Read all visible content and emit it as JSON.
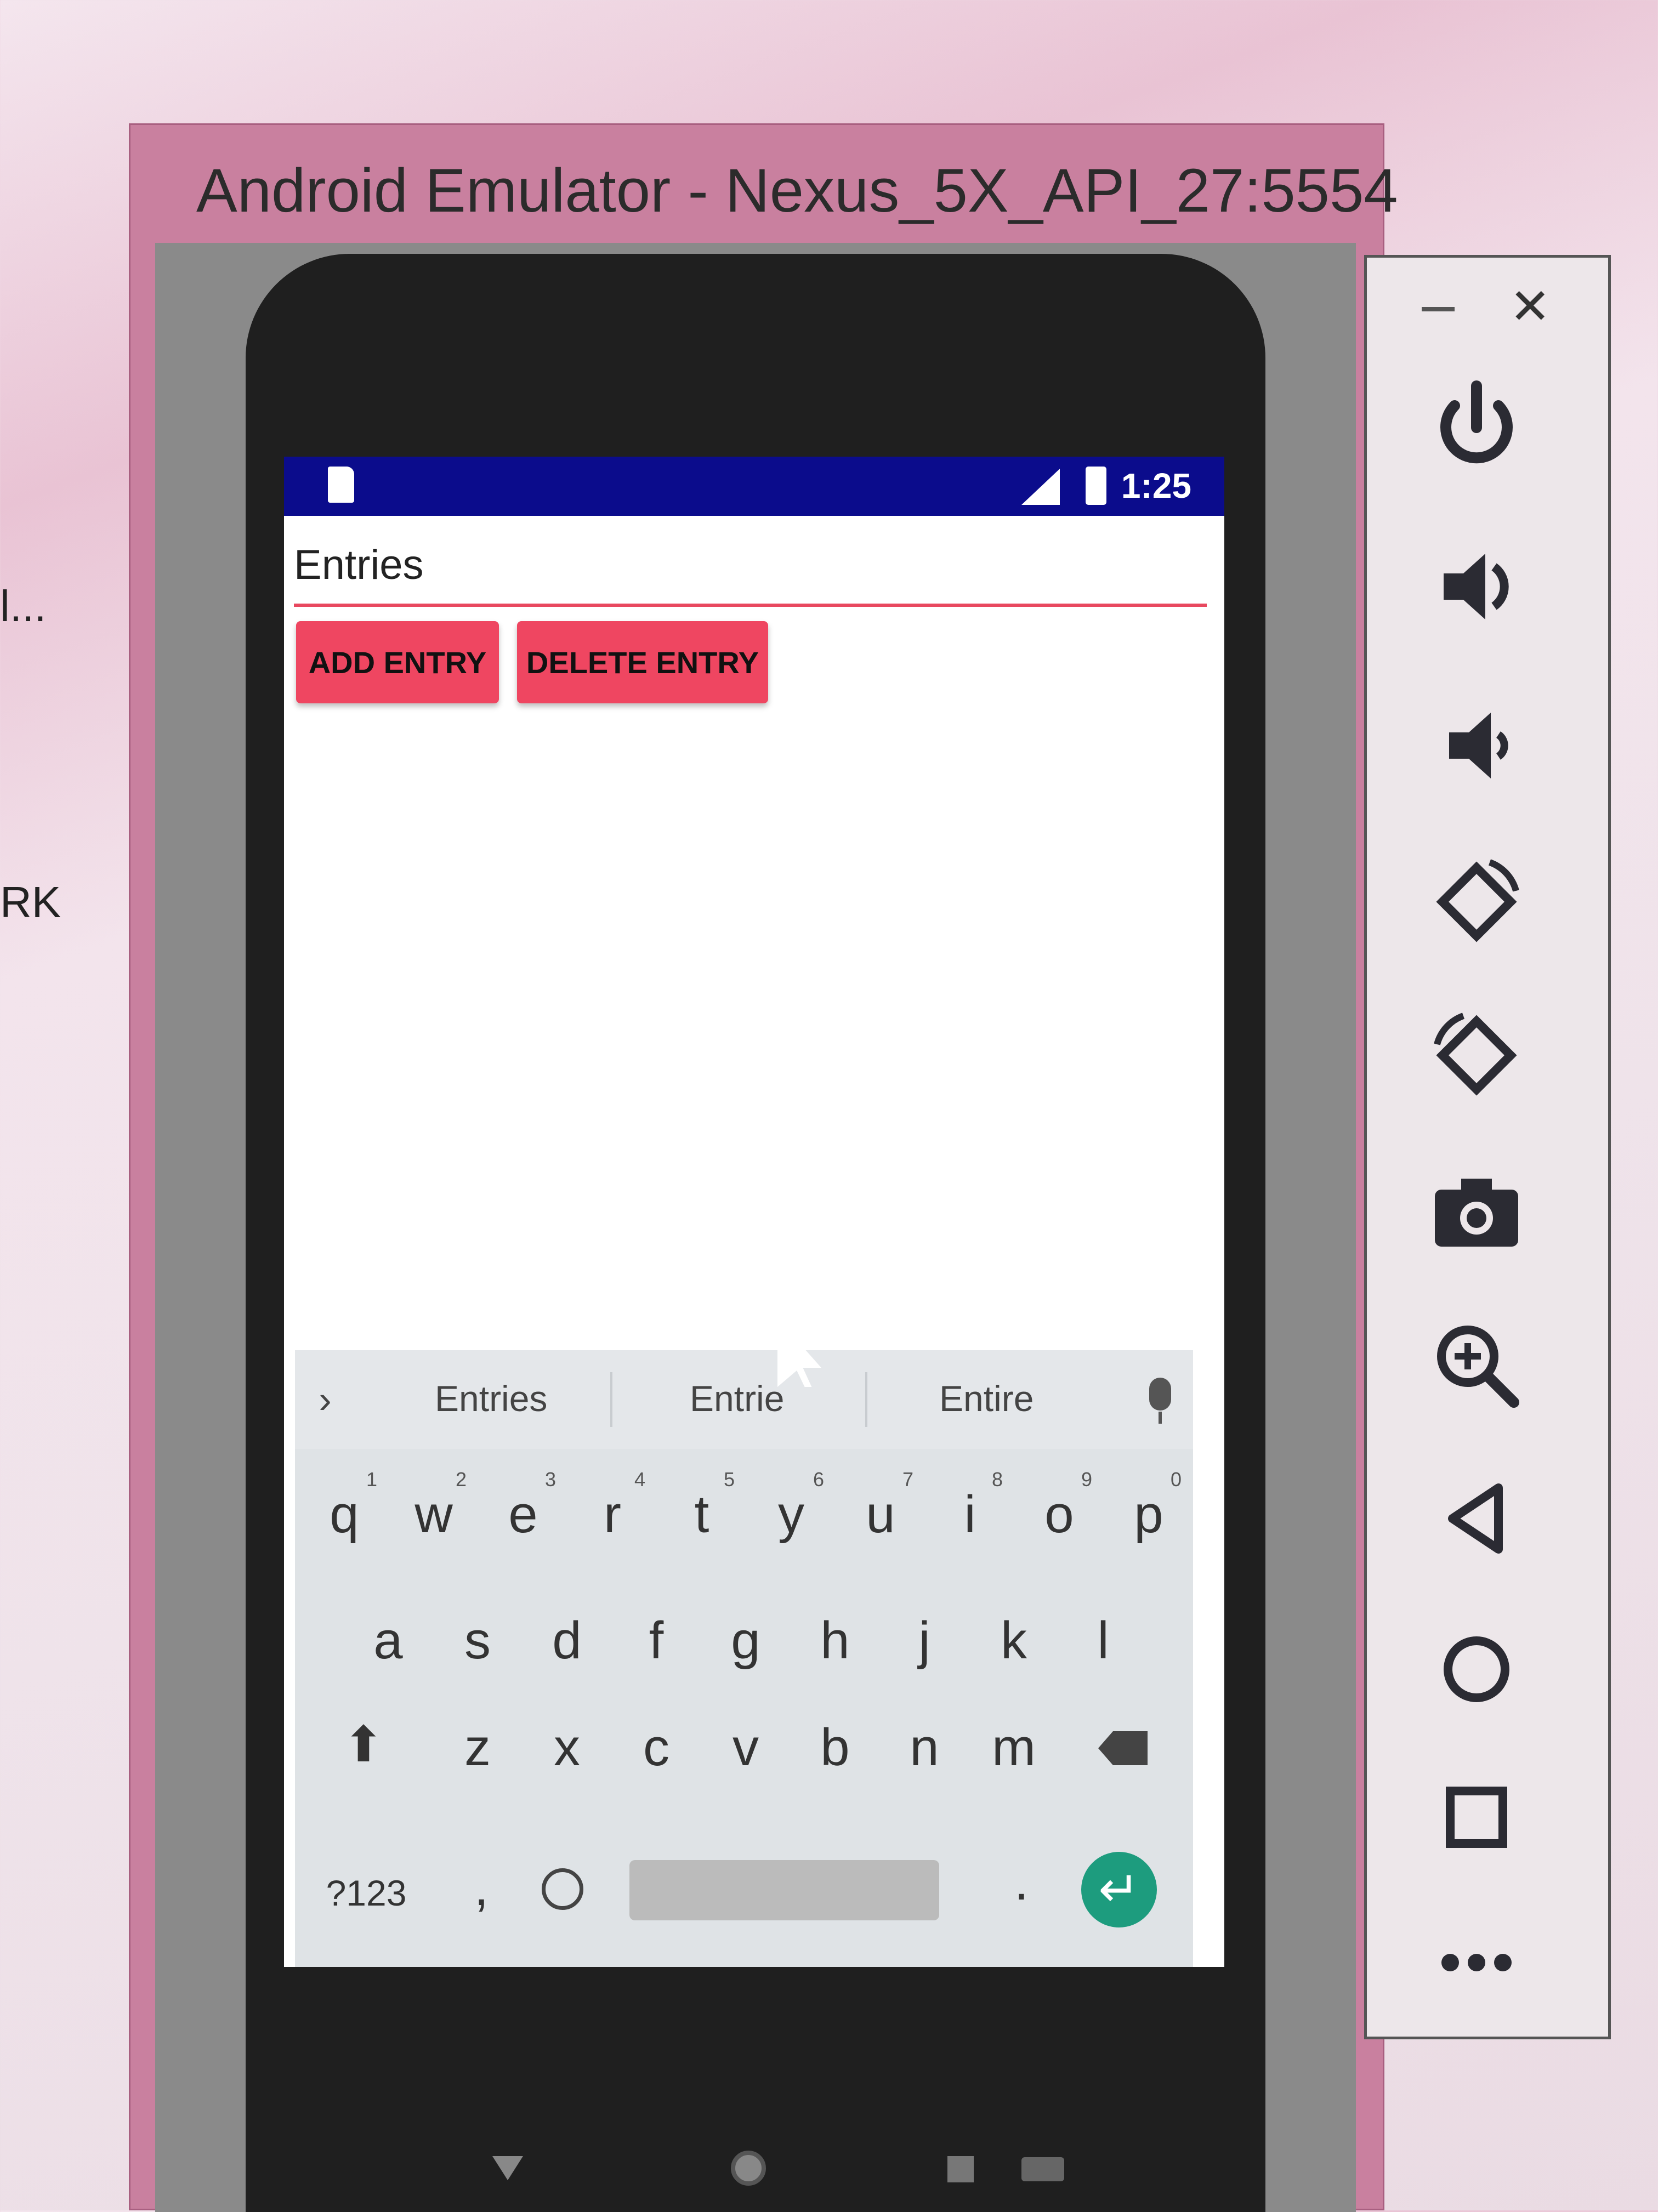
{
  "window": {
    "title": "Android Emulator - Nexus_5X_API_27:5554"
  },
  "desktop": {
    "left_labels": [
      "l...",
      "RK"
    ]
  },
  "status_bar": {
    "time": "1:25"
  },
  "app": {
    "entry_field_value": "Entries",
    "add_button_label": "ADD ENTRY",
    "delete_button_label": "DELETE ENTRY"
  },
  "keyboard": {
    "suggestions": [
      "Entries",
      "Entrie",
      "Entire"
    ],
    "row1": [
      {
        "key": "q",
        "hint": "1"
      },
      {
        "key": "w",
        "hint": "2"
      },
      {
        "key": "e",
        "hint": "3"
      },
      {
        "key": "r",
        "hint": "4"
      },
      {
        "key": "t",
        "hint": "5"
      },
      {
        "key": "y",
        "hint": "6"
      },
      {
        "key": "u",
        "hint": "7"
      },
      {
        "key": "i",
        "hint": "8"
      },
      {
        "key": "o",
        "hint": "9"
      },
      {
        "key": "p",
        "hint": "0"
      }
    ],
    "row2": [
      "a",
      "s",
      "d",
      "f",
      "g",
      "h",
      "j",
      "k",
      "l"
    ],
    "row3": [
      "z",
      "x",
      "c",
      "v",
      "b",
      "n",
      "m"
    ],
    "symbols_label": "?123",
    "comma": ",",
    "period": "."
  },
  "toolbar": {
    "icons": [
      "power-icon",
      "volume-up-icon",
      "volume-down-icon",
      "rotate-left-icon",
      "rotate-right-icon",
      "camera-icon",
      "zoom-icon",
      "back-icon",
      "home-icon",
      "overview-icon",
      "more-icon"
    ]
  },
  "colors": {
    "status_bar": "#0b0c8c",
    "accent": "#ef4661",
    "enter_key": "#1d9c7e"
  }
}
